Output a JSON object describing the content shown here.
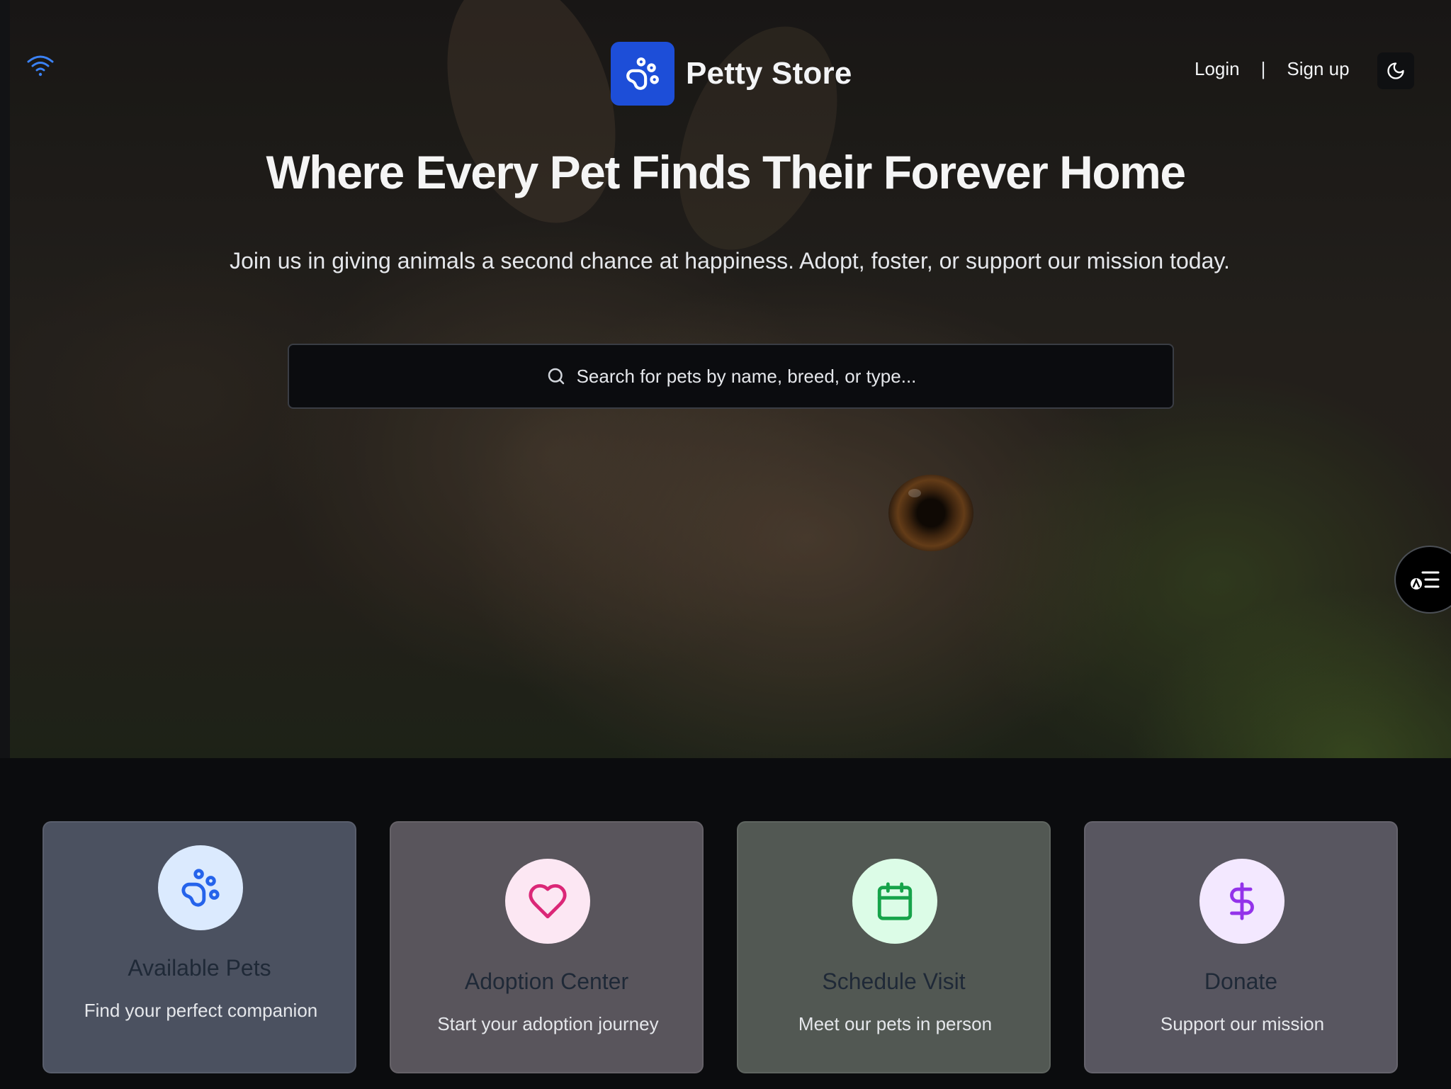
{
  "header": {
    "brand_name": "Petty Store",
    "login_label": "Login",
    "separator": "|",
    "signup_label": "Sign up"
  },
  "hero": {
    "title": "Where Every Pet Finds Their Forever Home",
    "subtitle": "Join us in giving animals a second chance at happiness. Adopt, foster, or support our mission today.",
    "search_placeholder": "Search for pets by name, breed, or type..."
  },
  "cards": [
    {
      "title": "Available Pets",
      "description": "Find your perfect companion",
      "icon": "paw-icon",
      "accent": "#2563eb",
      "bubble": "#dbeafe"
    },
    {
      "title": "Adoption Center",
      "description": "Start your adoption journey",
      "icon": "heart-icon",
      "accent": "#db2777",
      "bubble": "#fce7f3"
    },
    {
      "title": "Schedule Visit",
      "description": "Meet our pets in person",
      "icon": "calendar-icon",
      "accent": "#16a34a",
      "bubble": "#dcfce7"
    },
    {
      "title": "Donate",
      "description": "Support our mission",
      "icon": "dollar-icon",
      "accent": "#9333ea",
      "bubble": "#f3e8ff"
    }
  ],
  "colors": {
    "brand": "#1d4ed8",
    "background": "#0b0c0e"
  }
}
